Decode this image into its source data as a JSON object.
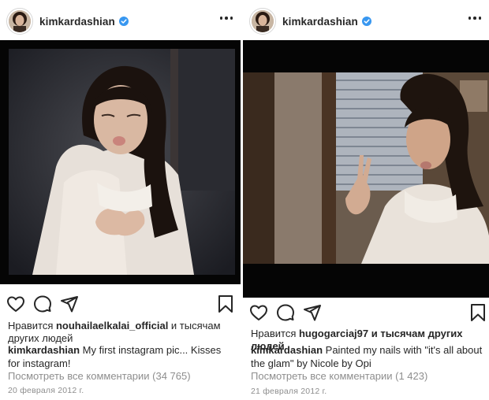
{
  "posts": [
    {
      "username": "kimkardashian",
      "likes_prefix": "Нравится ",
      "likes_user": "nouhailaelkalai_official",
      "likes_suffix": " и тысячам других людей",
      "caption_user": "kimkardashian",
      "caption_text": " My first instagram pic... Kisses for instagram!",
      "comments_link": "Посмотреть все комментарии (34 765)",
      "date": "20 февраля 2012 г."
    },
    {
      "username": "kimkardashian",
      "likes_prefix": "Нравится ",
      "likes_user": "hugogarciaj97",
      "likes_suffix": " и тысячам других людей",
      "caption_user": "kimkardashian",
      "caption_text": " Painted my nails with \"it's all about the glam\" by Nicole by Opi",
      "comments_link": "Посмотреть все комментарии (1 423)",
      "date": "21 февраля 2012 г."
    }
  ],
  "icons": {
    "verified": "verified-badge-icon",
    "more": "more-options-icon",
    "like": "heart-icon",
    "comment": "comment-icon",
    "share": "paper-plane-icon",
    "save": "bookmark-icon"
  },
  "colors": {
    "verified": "#3897f0",
    "text": "#262626",
    "secondary": "#8e8e8e"
  }
}
